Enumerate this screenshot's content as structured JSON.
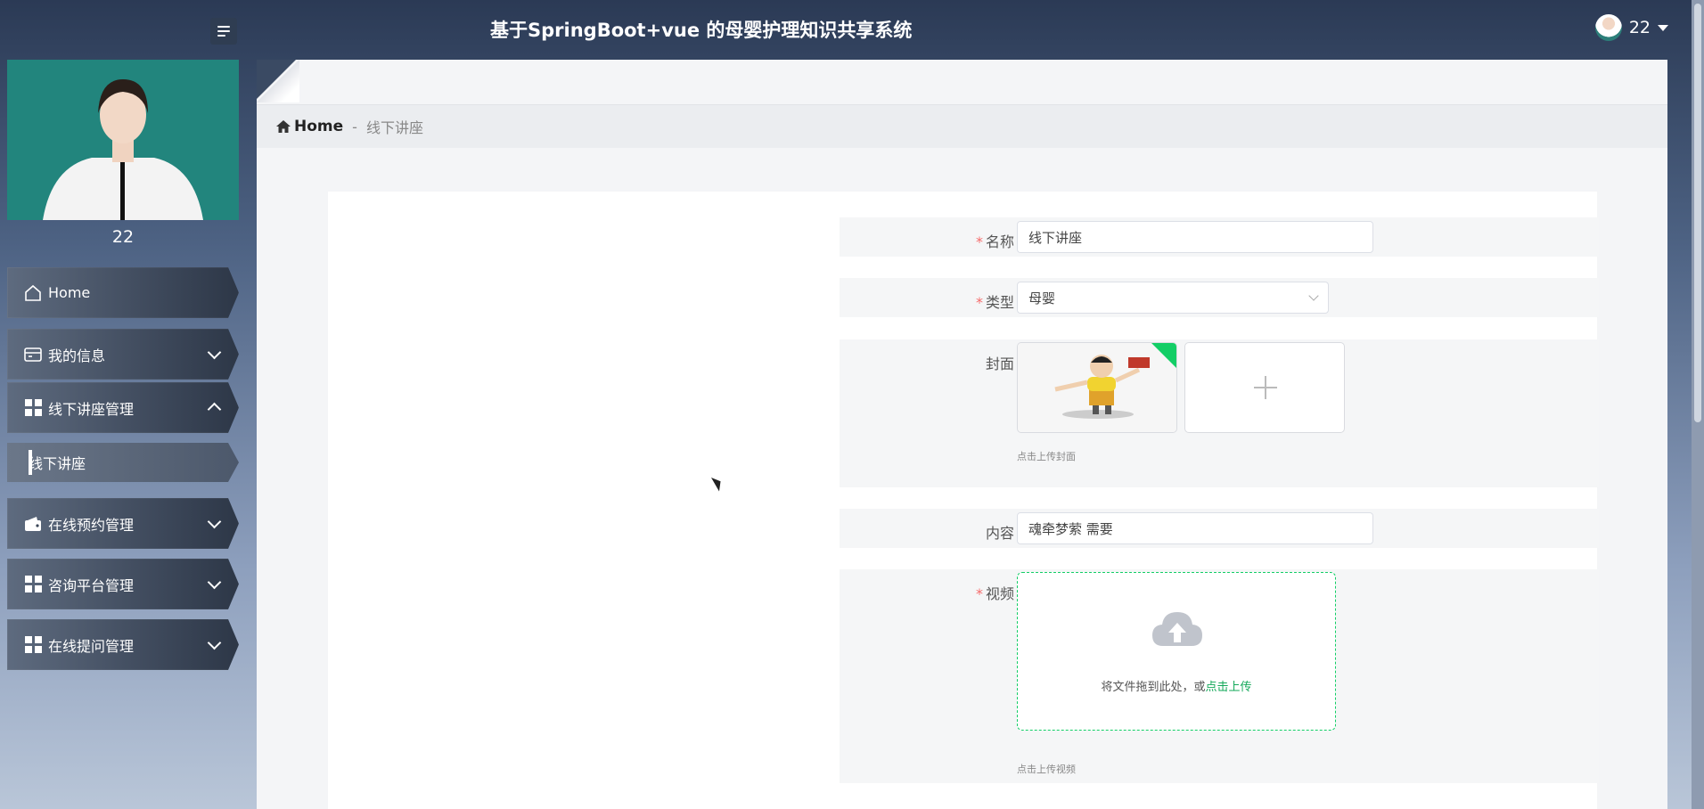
{
  "header": {
    "title": "基于SpringBoot+vue 的母婴护理知识共享系统",
    "user_name": "22"
  },
  "sidebar": {
    "profile_name": "22",
    "items": [
      {
        "label": "Home",
        "icon": "home-icon"
      },
      {
        "label": "我的信息",
        "icon": "id-card-icon"
      },
      {
        "label": "线下讲座管理",
        "icon": "grid-icon"
      },
      {
        "label": "在线预约管理",
        "icon": "wallet-icon"
      },
      {
        "label": "咨询平台管理",
        "icon": "grid-icon"
      },
      {
        "label": "在线提问管理",
        "icon": "grid-icon"
      }
    ],
    "sub_items": [
      {
        "label": "线下讲座"
      }
    ]
  },
  "breadcrumb": {
    "home": "Home",
    "separator": "-",
    "current": "线下讲座"
  },
  "form": {
    "name": {
      "label": "名称",
      "value": "线下讲座"
    },
    "type": {
      "label": "类型",
      "value": "母婴"
    },
    "cover": {
      "label": "封面",
      "hint": "点击上传封面"
    },
    "content": {
      "label": "内容",
      "value": "魂牵梦萦 需要"
    },
    "video": {
      "label": "视频",
      "upload_text": "将文件拖到此处，或",
      "upload_link": "点击上传",
      "hint": "点击上传视频"
    },
    "required_mark": "*"
  },
  "colors": {
    "accent": "#13ce66",
    "required": "#f56c6c"
  }
}
